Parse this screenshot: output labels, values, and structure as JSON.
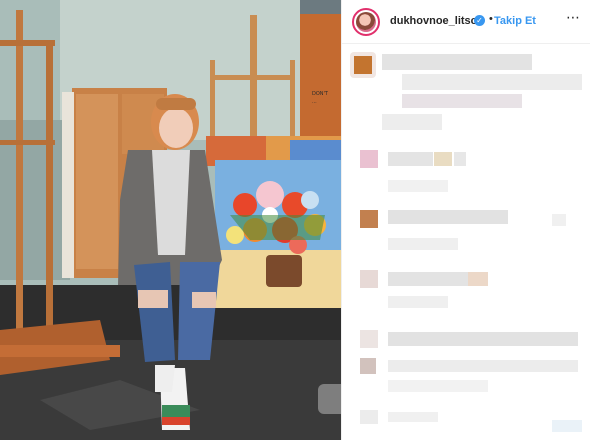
{
  "post": {
    "image_alt": "photo-of-woman-in-art-studio"
  },
  "header": {
    "username": "dukhovnoe_litso",
    "verified_icon": "verified-badge-icon",
    "separator": "•",
    "follow_label": "Takip Et",
    "more_icon": "more-options-icon",
    "more_glyph": "⋯"
  },
  "comments": {
    "pixelated": true,
    "blocks": 7
  },
  "colors": {
    "follow": "#3897f0",
    "verified": "#3897f0",
    "avatar_ring": "#e1306c",
    "text": "#262626"
  }
}
